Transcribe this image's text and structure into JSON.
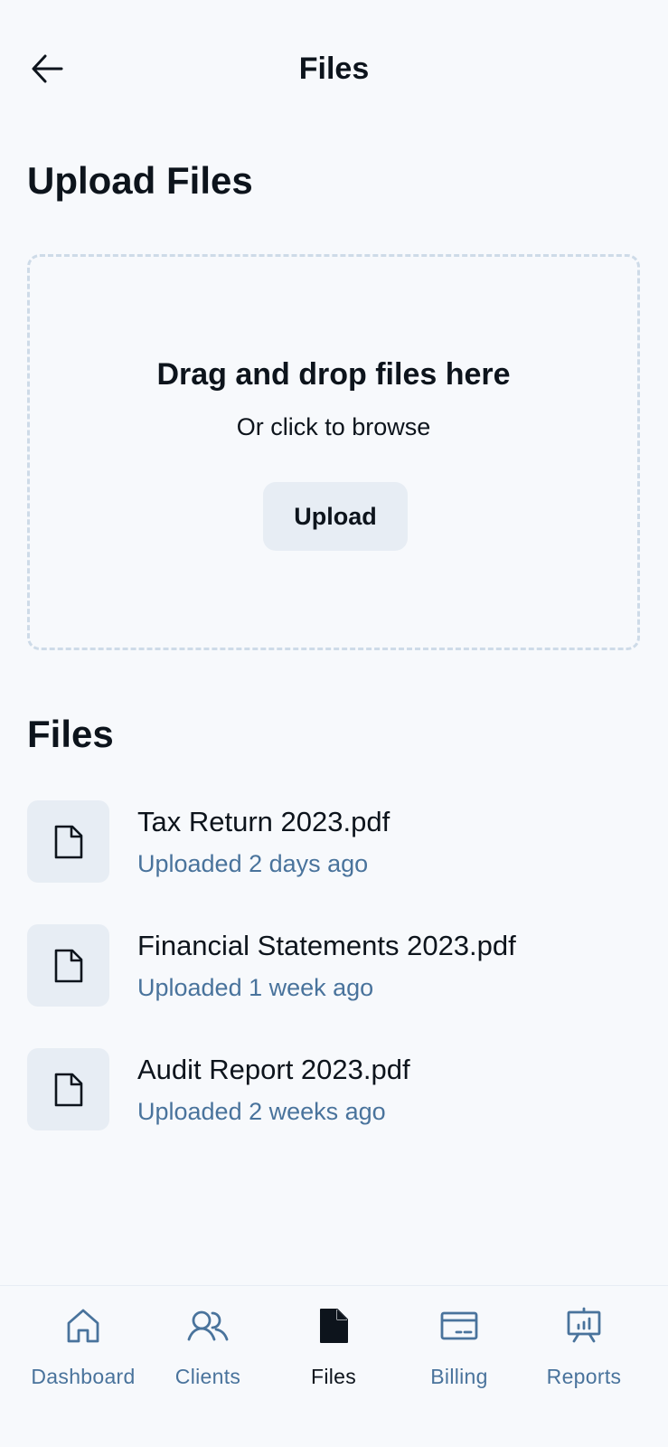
{
  "header": {
    "title": "Files",
    "back_icon": "arrow-left-icon"
  },
  "upload_section": {
    "heading": "Upload Files",
    "drop_title": "Drag and drop files here",
    "drop_subtitle": "Or click to browse",
    "upload_button": "Upload"
  },
  "files_section": {
    "heading": "Files",
    "items": [
      {
        "name": "Tax Return 2023.pdf",
        "meta": "Uploaded 2 days ago",
        "icon": "file-icon"
      },
      {
        "name": "Financial Statements 2023.pdf",
        "meta": "Uploaded 1 week ago",
        "icon": "file-icon"
      },
      {
        "name": "Audit Report 2023.pdf",
        "meta": "Uploaded 2 weeks ago",
        "icon": "file-icon"
      }
    ]
  },
  "bottom_nav": {
    "items": [
      {
        "label": "Dashboard",
        "icon": "house-icon",
        "active": false
      },
      {
        "label": "Clients",
        "icon": "users-icon",
        "active": false
      },
      {
        "label": "Files",
        "icon": "file-filled-icon",
        "active": true
      },
      {
        "label": "Billing",
        "icon": "credit-card-icon",
        "active": false
      },
      {
        "label": "Reports",
        "icon": "presentation-chart-icon",
        "active": false
      }
    ]
  },
  "colors": {
    "background": "#f7f9fc",
    "text_primary": "#0d141c",
    "text_secondary": "#49739c",
    "surface": "#e7edf4",
    "dashed_border": "#cedbe8"
  }
}
